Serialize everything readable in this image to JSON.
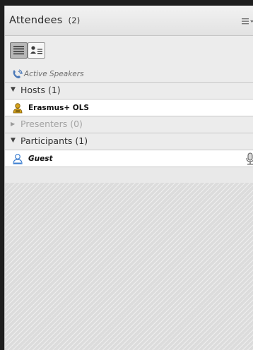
{
  "attendees": {
    "title": "Attendees",
    "count": "(2)",
    "menu_icon": "list-menu-icon"
  },
  "toolbar": {
    "list_view_icon": "list-view-icon",
    "detail_view_icon": "detail-view-icon",
    "selected": "list-view"
  },
  "active_speakers": {
    "label": "Active Speakers",
    "icon": "phone-speaker-icon"
  },
  "sections": [
    {
      "label": "Hosts (1)",
      "expanded": true
    },
    {
      "label": "Presenters (0)",
      "expanded": false
    },
    {
      "label": "Participants (1)",
      "expanded": true
    }
  ],
  "hosts": [
    {
      "name": "Erasmus+ OLS",
      "icon": "host-user-icon"
    }
  ],
  "participants": [
    {
      "name": "Guest",
      "icon": "user-icon",
      "status_icon": "microphone-icon"
    }
  ],
  "colors": {
    "background": "#1e1e1e",
    "panel": "#e9e9e9",
    "row_white": "#ffffff",
    "user_blue": "#3d7fd0",
    "host_gold": "#d6a31d"
  }
}
